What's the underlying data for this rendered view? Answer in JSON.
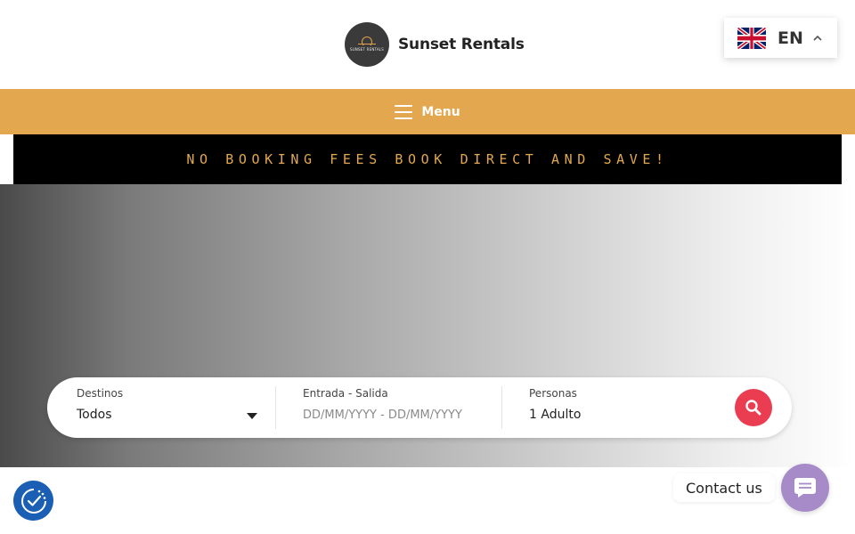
{
  "header": {
    "brand_name": "Sunset Rentals",
    "logo_text": "SUNSET RENTALS"
  },
  "language": {
    "code": "EN",
    "flag_icon": "uk-flag-icon",
    "caret_icon": "chevron-up-icon"
  },
  "nav": {
    "menu_label": "Menu",
    "menu_icon": "hamburger-icon"
  },
  "promo": {
    "text": "NO BOOKING FEES BOOK DIRECT AND SAVE!"
  },
  "search": {
    "destination": {
      "label": "Destinos",
      "value": "Todos"
    },
    "dates": {
      "label": "Entrada - Salida",
      "placeholder": "DD/MM/YYYY - DD/MM/YYYY"
    },
    "guests": {
      "label": "Personas",
      "value": "1 Adulto"
    },
    "button_icon": "search-icon"
  },
  "floating": {
    "cookie_icon": "cookie-consent-icon",
    "contact_label": "Contact us",
    "contact_icon": "chat-icon"
  },
  "colors": {
    "accent": "#e2a74f",
    "promo_bg": "#000000",
    "search_button": "#ea3d52",
    "contact_button": "#a78bc9",
    "cookie_button": "#1a5fb4"
  }
}
